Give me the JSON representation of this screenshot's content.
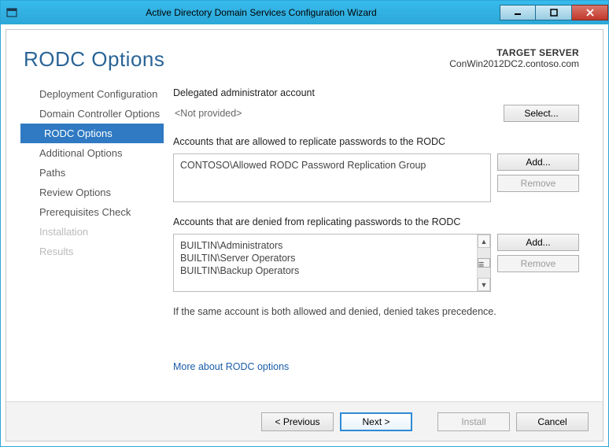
{
  "window": {
    "title": "Active Directory Domain Services Configuration Wizard"
  },
  "header": {
    "page_title": "RODC Options",
    "target_label": "TARGET SERVER",
    "target_server": "ConWin2012DC2.contoso.com"
  },
  "nav": {
    "items": [
      {
        "label": "Deployment Configuration",
        "state": "normal"
      },
      {
        "label": "Domain Controller Options",
        "state": "normal"
      },
      {
        "label": "RODC Options",
        "state": "selected"
      },
      {
        "label": "Additional Options",
        "state": "normal"
      },
      {
        "label": "Paths",
        "state": "normal"
      },
      {
        "label": "Review Options",
        "state": "normal"
      },
      {
        "label": "Prerequisites Check",
        "state": "normal"
      },
      {
        "label": "Installation",
        "state": "disabled"
      },
      {
        "label": "Results",
        "state": "disabled"
      }
    ]
  },
  "main": {
    "delegated_label": "Delegated administrator account",
    "delegated_value": "<Not provided>",
    "select_btn": "Select...",
    "allowed_label": "Accounts that are allowed to replicate passwords to the RODC",
    "allowed_items": [
      "CONTOSO\\Allowed RODC Password Replication Group"
    ],
    "denied_label": "Accounts that are denied from replicating passwords to the RODC",
    "denied_items": [
      "BUILTIN\\Administrators",
      "BUILTIN\\Server Operators",
      "BUILTIN\\Backup Operators"
    ],
    "add_btn": "Add...",
    "remove_btn": "Remove",
    "precedence_note": "If the same account is both allowed and denied, denied takes precedence.",
    "more_link": "More about RODC options"
  },
  "footer": {
    "previous": "< Previous",
    "next": "Next >",
    "install": "Install",
    "cancel": "Cancel"
  }
}
